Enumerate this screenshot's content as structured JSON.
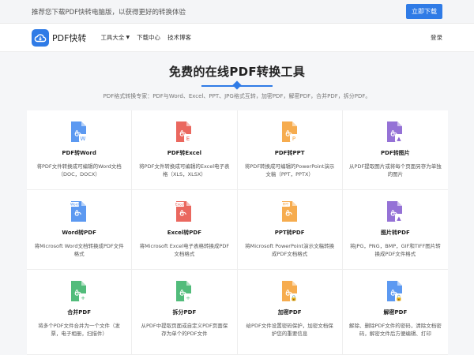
{
  "promo": {
    "text": "推荐您下载PDF快转电脑版，以获得更好的转换体验",
    "button": "立即下载"
  },
  "nav": {
    "brand": "PDF快转",
    "menu": [
      {
        "label": "工具大全"
      },
      {
        "label": "下载中心"
      },
      {
        "label": "技术博客"
      }
    ],
    "login": "登录"
  },
  "hero": {
    "title": "免费的在线PDF转换工具",
    "subtitle": "PDF格式转换专家：PDF与Word、Excel、PPT、JPG格式互转，加密PDF，解密PDF，合并PDF，拆分PDF。"
  },
  "tools": [
    {
      "title": "PDF转Word",
      "desc": "将PDF文件转换成可编辑的Word文档（DOC，DOCX）",
      "color": "#4a8ef0",
      "icon": "pdf-to-word-icon",
      "badge": "W"
    },
    {
      "title": "PDF转Excel",
      "desc": "将PDF文件转换成可编辑的Excel电子表格（XLS，XLSX）",
      "color": "#e8584e",
      "icon": "pdf-to-excel-icon",
      "badge": "E"
    },
    {
      "title": "PDF转PPT",
      "desc": "将PDF转换成可编辑的PowerPoint演示文稿（PPT，PPTX）",
      "color": "#f5a33c",
      "icon": "pdf-to-ppt-icon",
      "badge": "P"
    },
    {
      "title": "PDF转图片",
      "desc": "从PDF提取图片或将每个页面另存为单独的图片",
      "color": "#8a63d2",
      "icon": "pdf-to-image-icon",
      "badge": "▲"
    },
    {
      "title": "Word转PDF",
      "desc": "将Microsoft Word文档转换成PDF文件格式",
      "color": "#4a8ef0",
      "icon": "word-to-pdf-icon",
      "badge": "Word"
    },
    {
      "title": "Excel转PDF",
      "desc": "将Microsoft Excel电子表格转换成PDF文档格式",
      "color": "#e8584e",
      "icon": "excel-to-pdf-icon",
      "badge": "Excel"
    },
    {
      "title": "PPT转PDF",
      "desc": "将Microsoft PowerPoint演示文稿转换成PDF文档格式",
      "color": "#f5a33c",
      "icon": "ppt-to-pdf-icon",
      "badge": "PPT"
    },
    {
      "title": "图片转PDF",
      "desc": "将JPG，PNG，BMP，GIF和TIFF图片转换成PDF文件格式",
      "color": "#8a63d2",
      "icon": "image-to-pdf-icon",
      "badge": "▲"
    },
    {
      "title": "合并PDF",
      "desc": "将多个PDF文件合并为一个文件（发票，电子相册，扫描件）",
      "color": "#3fb56d",
      "icon": "merge-pdf-icon",
      "badge": "+"
    },
    {
      "title": "拆分PDF",
      "desc": "从PDF中提取页面或自定义PDF页面保存为单个的PDF文件",
      "color": "#3fb56d",
      "icon": "split-pdf-icon",
      "badge": "÷"
    },
    {
      "title": "加密PDF",
      "desc": "给PDF文件设置密码保护，加密文档保护您的重要信息",
      "color": "#f5a33c",
      "icon": "encrypt-pdf-icon",
      "badge": "🔒"
    },
    {
      "title": "解密PDF",
      "desc": "解除、删除PDF文件的密码，清除文档密码，解密文件后方便编辑、打印",
      "color": "#4a8ef0",
      "icon": "decrypt-pdf-icon",
      "badge": "🔓"
    }
  ],
  "colors": {
    "accent": "#2f7be6"
  }
}
